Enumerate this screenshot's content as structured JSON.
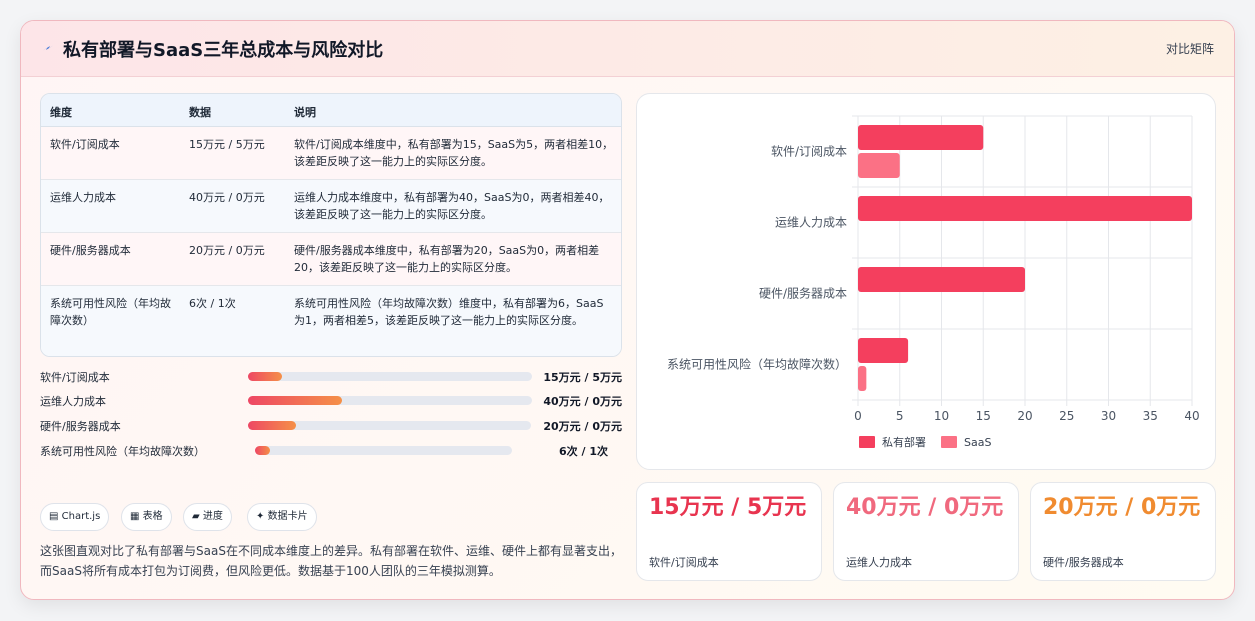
{
  "header": {
    "title": "私有部署与SaaS三年总成本与风险对比",
    "badge": "对比矩阵",
    "icon": "sparkle-icon"
  },
  "table": {
    "headers": [
      "维度",
      "数据",
      "说明"
    ],
    "rows": [
      {
        "dimension": "软件/订阅成本",
        "data": "15万元 / 5万元",
        "note": "软件/订阅成本维度中，私有部署为15，SaaS为5，两者相差10，该差距反映了这一能力上的实际区分度。"
      },
      {
        "dimension": "运维人力成本",
        "data": "40万元 / 0万元",
        "note": "运维人力成本维度中，私有部署为40，SaaS为0，两者相差40，该差距反映了这一能力上的实际区分度。"
      },
      {
        "dimension": "硬件/服务器成本",
        "data": "20万元 / 0万元",
        "note": "硬件/服务器成本维度中，私有部署为20，SaaS为0，两者相差20，该差距反映了这一能力上的实际区分度。"
      },
      {
        "dimension": "系统可用性风险（年均故障次数）",
        "data": "6次 / 1次",
        "note": "系统可用性风险（年均故障次数）维度中，私有部署为6，SaaS为1，两者相差5，该差距反映了这一能力上的实际区分度。"
      }
    ]
  },
  "progress": [
    {
      "label": "软件/订阅成本",
      "value": "15万元 / 5万元",
      "fraction": 0.12
    },
    {
      "label": "运维人力成本",
      "value": "40万元 / 0万元",
      "fraction": 0.33
    },
    {
      "label": "硬件/服务器成本",
      "value": "20万元 / 0万元",
      "fraction": 0.17
    },
    {
      "label": "系统可用性风险（年均故障次数）",
      "value": "6次 / 1次",
      "fraction": 0.06
    }
  ],
  "tags": [
    {
      "icon": "chart-icon",
      "glyph": "▤",
      "label": "Chart.js"
    },
    {
      "icon": "table-icon",
      "glyph": "▦",
      "label": "表格"
    },
    {
      "icon": "folder-icon",
      "glyph": "▰",
      "label": "进度"
    },
    {
      "icon": "sparkle-icon",
      "glyph": "✦",
      "label": "数据卡片"
    }
  ],
  "description": "这张图直观对比了私有部署与SaaS在不同成本维度上的差异。私有部署在软件、运维、硬件上都有显著支出，而SaaS将所有成本打包为订阅费，但风险更低。数据基于100人团队的三年模拟测算。",
  "stats": [
    {
      "value": "15万元 / 5万元",
      "label": "软件/订阅成本",
      "color": "#e8344f"
    },
    {
      "value": "40万元 / 0万元",
      "label": "运维人力成本",
      "color": "#f0697e"
    },
    {
      "value": "20万元 / 0万元",
      "label": "硬件/服务器成本",
      "color": "#f08b30"
    }
  ],
  "chart_data": {
    "type": "bar",
    "orientation": "horizontal",
    "categories": [
      "软件/订阅成本",
      "运维人力成本",
      "硬件/服务器成本",
      "系统可用性风险（年均故障次数）"
    ],
    "series": [
      {
        "name": "私有部署",
        "values": [
          15,
          40,
          20,
          6
        ],
        "color": "#f43f5e"
      },
      {
        "name": "SaaS",
        "values": [
          5,
          0,
          0,
          1
        ],
        "color": "#fb7185"
      }
    ],
    "xlim": [
      0,
      40
    ],
    "xticks": [
      0,
      5,
      10,
      15,
      20,
      25,
      30,
      35,
      40
    ],
    "grid": true,
    "legend": "bottom"
  }
}
